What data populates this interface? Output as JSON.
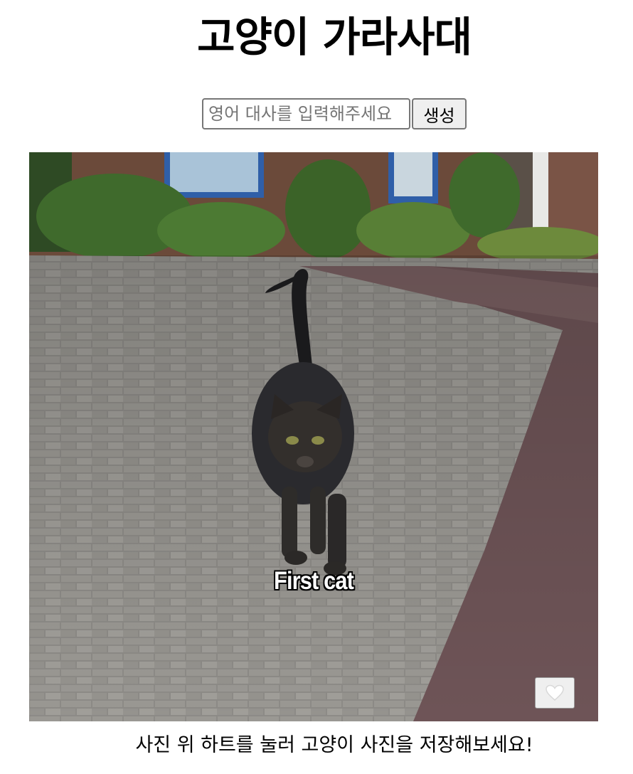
{
  "page": {
    "title": "고양이 가라사대"
  },
  "form": {
    "input_placeholder": "영어 대사를 입력해주세요",
    "input_value": "",
    "generate_label": "생성"
  },
  "meme": {
    "caption": "First cat",
    "image_subject": "black tabby cat walking on brick pavement",
    "like_icon": "white-heart-icon"
  },
  "footer": {
    "instruction": "사진 위 하트를 눌러 고양이 사진을 저장해보세요!"
  }
}
